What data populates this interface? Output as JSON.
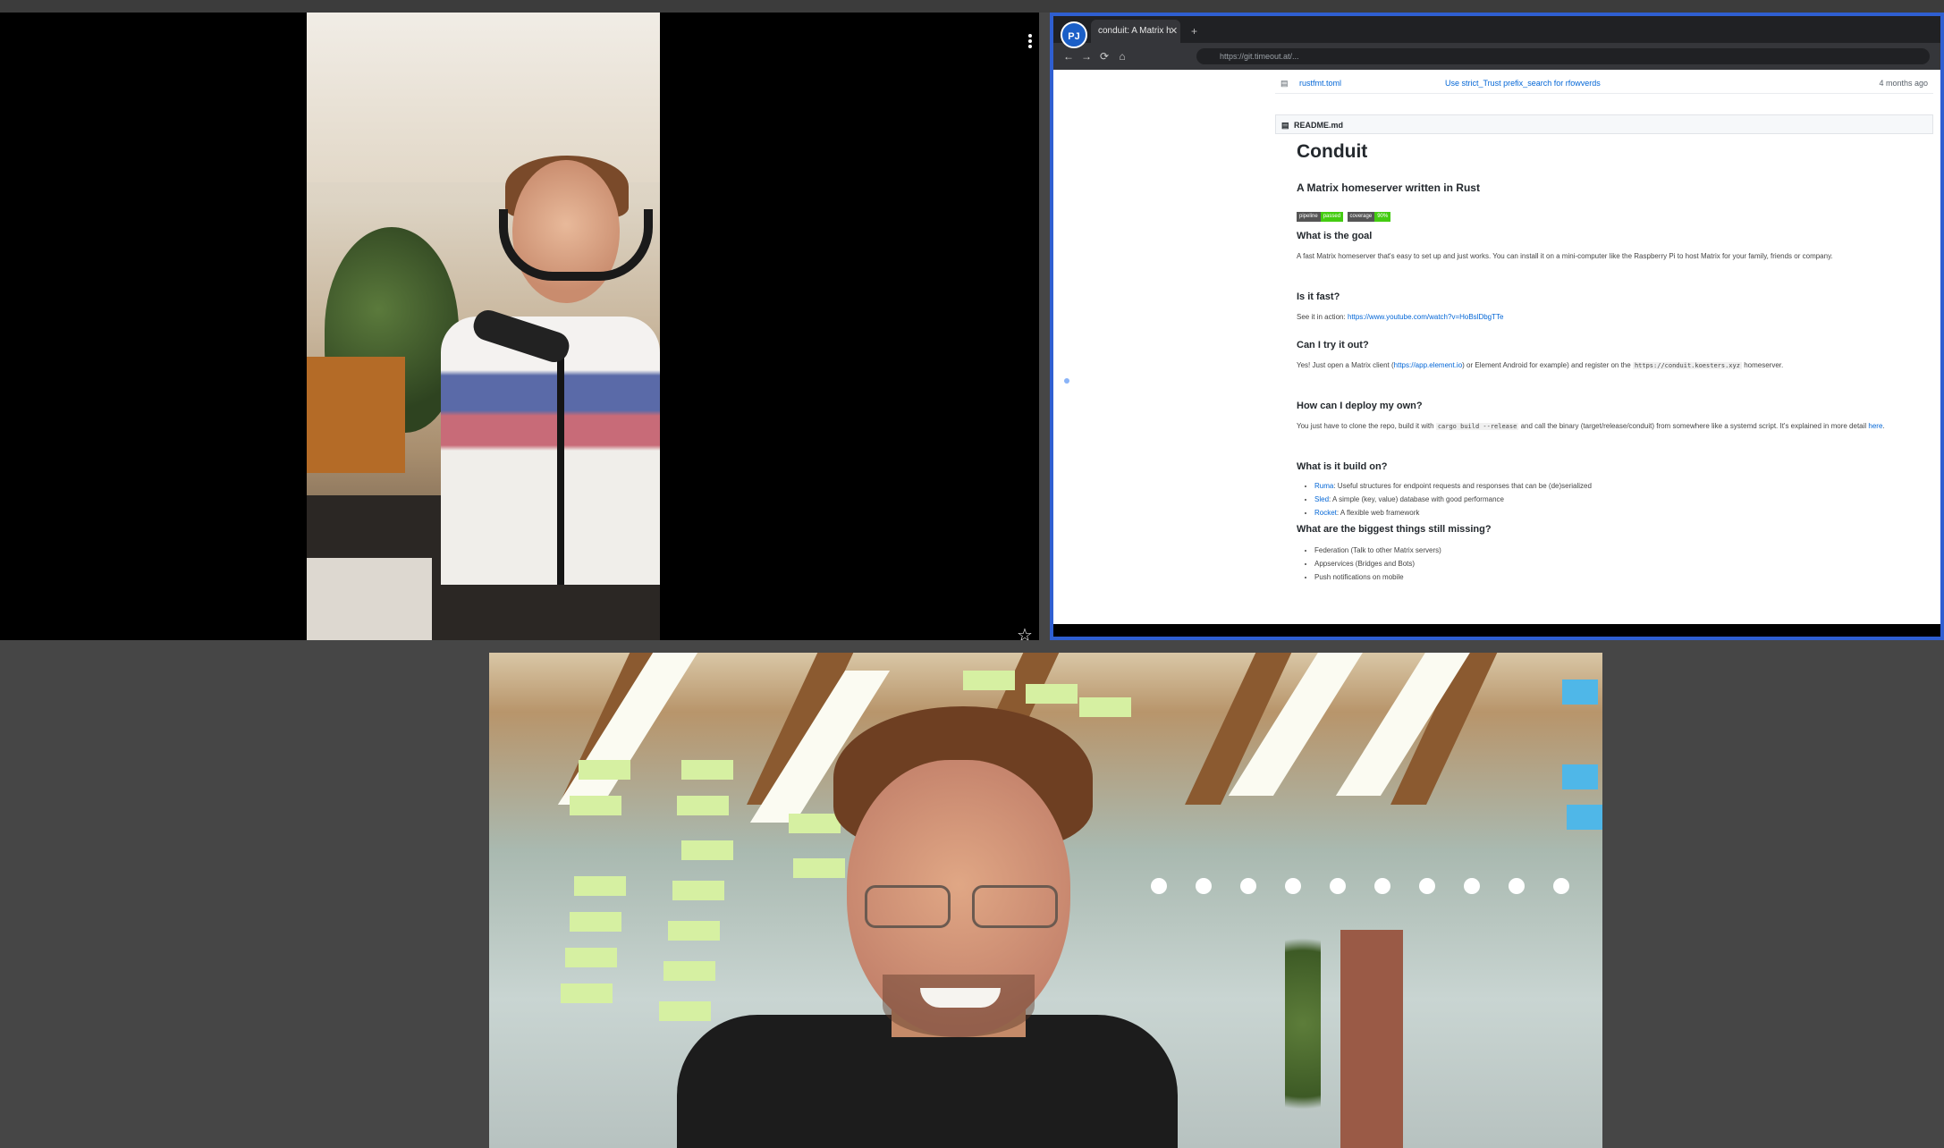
{
  "tile_shared_screen": {
    "browser": {
      "badge": "PJ",
      "tab_title": "conduit: A Matrix h",
      "tab_close": "✕",
      "tab_new": "+",
      "url": "https://git.timeout.at/...",
      "back": "←",
      "forward": "→",
      "reload": "⟳",
      "home": "⌂"
    },
    "file_row": {
      "name": "rustfmt.toml",
      "commit": "Use strict_Trust prefix_search for rfowverds",
      "age": "4 months ago"
    },
    "readme": {
      "header": "README.md",
      "title": "Conduit",
      "subtitle": "A Matrix homeserver written in Rust",
      "badges": [
        "pipeline",
        "passed",
        "coverage",
        "90%"
      ],
      "h_goal": "What is the goal",
      "p_goal": "A fast Matrix homeserver that's easy to set up and just works. You can install it on a mini-computer like the Raspberry Pi to host Matrix for your family, friends or company.",
      "h_fast": "Is it fast?",
      "p_fast_prefix": "See it in action:",
      "p_fast_link": "https://www.youtube.com/watch?v=HoBslDbgTTe",
      "h_try": "Can I try it out?",
      "p_try_prefix": "Yes! Just open a Matrix client (",
      "p_try_link": "https://app.element.io",
      "p_try_mid": ") or Element Android for example) and register on the",
      "p_try_code": "https://conduit.koesters.xyz",
      "p_try_suffix": "homeserver.",
      "h_deploy": "How can I deploy my own?",
      "p_deploy_prefix": "You just have to clone the repo, build it with",
      "p_deploy_code": "cargo build --release",
      "p_deploy_mid": "and call the binary (target/release/conduit) from somewhere like a systemd script. It's explained in more detail",
      "p_deploy_link": "here",
      "h_build": "What is it build on?",
      "build_items": [
        {
          "link": "Ruma",
          "text": ": Useful structures for endpoint requests and responses that can be (de)serialized"
        },
        {
          "link": "Sled",
          "text": ": A simple (key, value) database with good performance"
        },
        {
          "link": "Rocket",
          "text": ": A flexible web framework"
        }
      ],
      "h_missing": "What are the biggest things still missing?",
      "missing_items": [
        "Federation (Talk to other Matrix servers)",
        "Appservices (Bridges and Bots)",
        "Push notifications on mobile"
      ]
    }
  },
  "tile_controls": {
    "more_icon": "more-vertical-icon",
    "pin_icon": "star-icon",
    "pin_glyph": "☆"
  },
  "colors": {
    "active_speaker_border": "#2f5fd1",
    "background": "#464646"
  }
}
